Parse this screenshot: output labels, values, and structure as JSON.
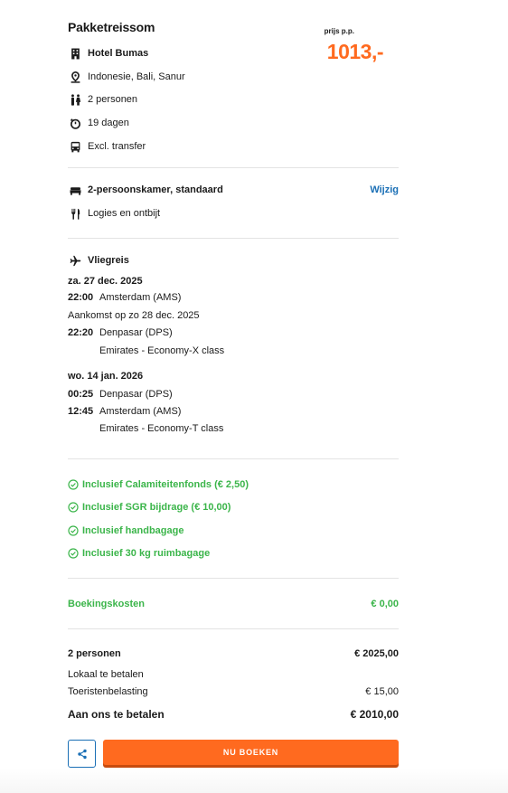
{
  "header": {
    "title": "Pakketreissom",
    "price_label": "prijs p.p.",
    "price": "1013,-"
  },
  "summary": [
    {
      "icon": "building-icon",
      "text": "Hotel Bumas",
      "bold": true
    },
    {
      "icon": "location-pin-icon",
      "text": "Indonesie, Bali, Sanur",
      "bold": false
    },
    {
      "icon": "persons-icon",
      "text": "2 personen",
      "bold": false
    },
    {
      "icon": "stopwatch-icon",
      "text": "19 dagen",
      "bold": false
    },
    {
      "icon": "bus-icon",
      "text": "Excl. transfer",
      "bold": false
    }
  ],
  "room": {
    "icon": "bed-icon",
    "label": "2-persoonskamer, standaard",
    "change_link": "Wijzig",
    "board_icon": "cutlery-icon",
    "board": "Logies en ontbijt"
  },
  "flight": {
    "icon": "airplane-icon",
    "title": "Vliegreis",
    "outbound": {
      "date": "za. 27 dec. 2025",
      "dep_time": "22:00",
      "dep_airport": "Amsterdam (AMS)",
      "arrival_note": "Aankomst op zo 28 dec. 2025",
      "arr_time": "22:20",
      "arr_airport": "Denpasar (DPS)",
      "carrier": "Emirates - Economy-X class"
    },
    "inbound": {
      "date": "wo. 14 jan. 2026",
      "dep_time": "00:25",
      "dep_airport": "Denpasar (DPS)",
      "arr_time": "12:45",
      "arr_airport": "Amsterdam (AMS)",
      "carrier": "Emirates - Economy-T class"
    }
  },
  "inclusions": [
    "Inclusief Calamiteitenfonds (€ 2,50)",
    "Inclusief SGR bijdrage (€ 10,00)",
    "Inclusief handbagage",
    "Inclusief 30 kg ruimbagage"
  ],
  "booking_costs": {
    "label": "Boekingskosten",
    "value": "€ 0,00"
  },
  "totals": {
    "persons_label": "2 personen",
    "persons_value": "€ 2025,00",
    "local_label": "Lokaal te betalen",
    "tax_label": "Toeristenbelasting",
    "tax_value": "€ 15,00",
    "pay_label": "Aan ons te betalen",
    "pay_value": "€ 2010,00"
  },
  "actions": {
    "share_icon": "share-icon",
    "book_label": "NU BOEKEN"
  },
  "colors": {
    "accent": "#ff6a1f",
    "link": "#1a6fb5",
    "green": "#3bb54a"
  }
}
